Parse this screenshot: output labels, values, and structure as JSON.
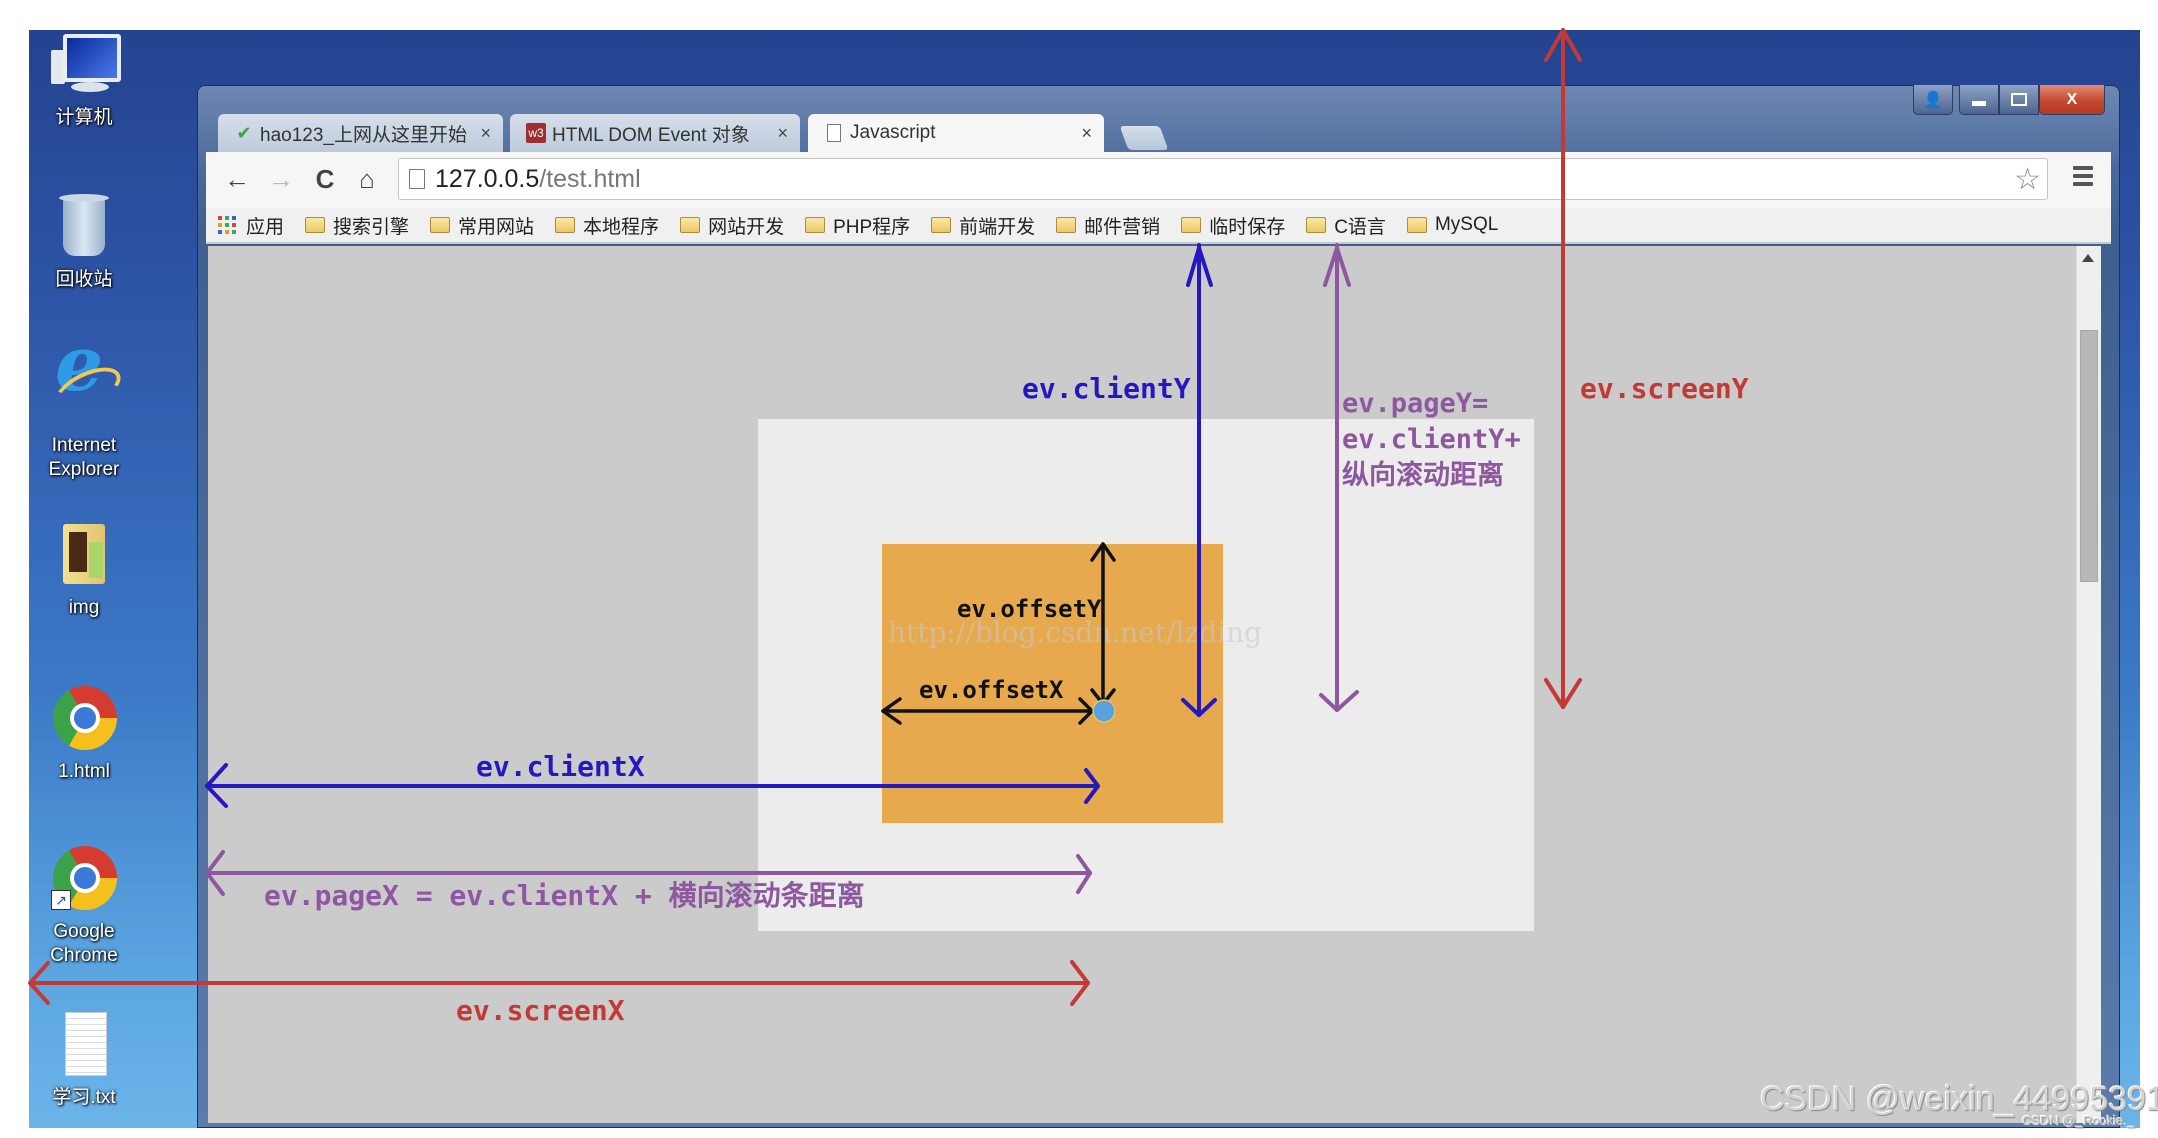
{
  "desktop": {
    "icons": [
      {
        "label": "计算机",
        "icon": "computer-icon"
      },
      {
        "label": "回收站",
        "icon": "recycle-bin-icon"
      },
      {
        "label": "Internet\nExplorer",
        "line1": "Internet",
        "line2": "Explorer",
        "icon": "internet-explorer-icon"
      },
      {
        "label": "img",
        "icon": "folder-icon"
      },
      {
        "label": "1.html",
        "icon": "chrome-html-file-icon"
      },
      {
        "label": "Google\nChrome",
        "line1": "Google",
        "line2": "Chrome",
        "icon": "chrome-shortcut-icon"
      },
      {
        "label": "学习.txt",
        "icon": "text-file-icon"
      }
    ]
  },
  "browser": {
    "tabs": [
      {
        "title": "hao123_上网从这里开始",
        "favicon": "hao123-icon",
        "close": "×",
        "active": false
      },
      {
        "title": "HTML DOM Event 对象",
        "favicon": "w3-icon",
        "favicon_text": "w3",
        "close": "×",
        "active": false
      },
      {
        "title": "Javascript",
        "favicon": "page-icon",
        "close": "×",
        "active": true
      }
    ],
    "window_controls": {
      "user": "user-icon",
      "minimize": "minimize-icon",
      "maximize": "maximize-icon",
      "close": "X"
    },
    "nav": {
      "back": "←",
      "forward": "→",
      "reload": "C",
      "home": "⌂"
    },
    "address": {
      "host": "127.0.0.5",
      "path": "/test.html"
    },
    "bookmarks": [
      {
        "label": "应用",
        "type": "apps"
      },
      {
        "label": "搜索引擎",
        "type": "folder"
      },
      {
        "label": "常用网站",
        "type": "folder"
      },
      {
        "label": "本地程序",
        "type": "folder"
      },
      {
        "label": "网站开发",
        "type": "folder"
      },
      {
        "label": "PHP程序",
        "type": "folder"
      },
      {
        "label": "前端开发",
        "type": "folder"
      },
      {
        "label": "邮件营销",
        "type": "folder"
      },
      {
        "label": "临时保存",
        "type": "folder"
      },
      {
        "label": "C语言",
        "type": "folder"
      },
      {
        "label": "MySQL",
        "type": "folder"
      }
    ]
  },
  "page": {
    "watermark": "http://blog.csdn.net/lzding"
  },
  "annotations": {
    "clientY": "ev.clientY",
    "pageY_line1": "ev.pageY=",
    "pageY_line2": "ev.clientY+",
    "pageY_line3": "纵向滚动距离",
    "screenY": "ev.screenY",
    "offsetY": "ev.offsetY",
    "offsetX": "ev.offsetX",
    "clientX": "ev.clientX",
    "pageX": "ev.pageX = ev.clientX + 横向滚动条距离",
    "screenX": "ev.screenX"
  },
  "colors": {
    "clientColor": "#2418c0",
    "pageColor": "#8e58a0",
    "screenColor": "#c23a36",
    "offsetColor": "#111111",
    "orangeBox": "#e6a94e",
    "lightBox": "#ececec",
    "pointDot": "#5aa2dc"
  },
  "footer_watermarks": {
    "main": "CSDN @weixin_44995391",
    "small": "CSDN @_Rookie._"
  }
}
